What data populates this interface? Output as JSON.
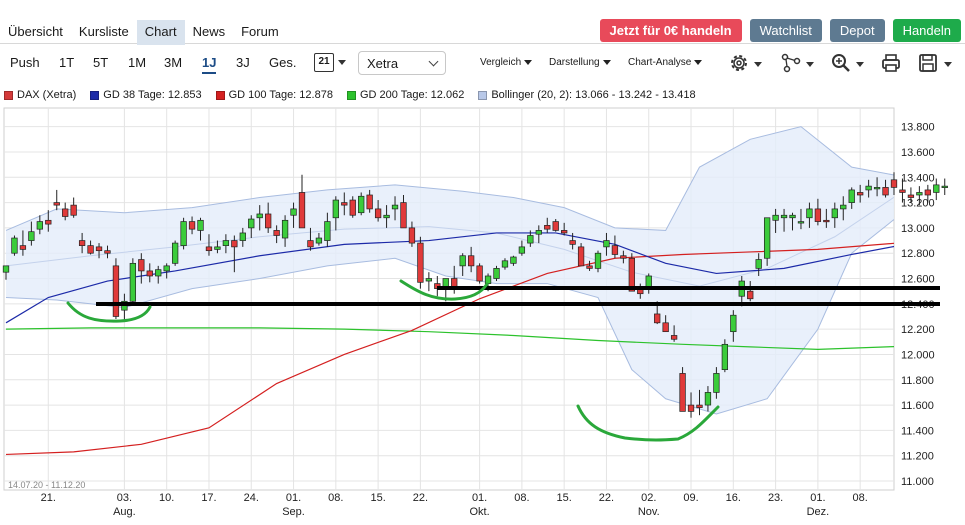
{
  "nav": {
    "items": [
      "Übersicht",
      "Kursliste",
      "Chart",
      "News",
      "Forum"
    ],
    "active": "Chart"
  },
  "actions": {
    "trade": "Jetzt für 0€ handeln",
    "watchlist": "Watchlist",
    "depot": "Depot",
    "handeln": "Handeln"
  },
  "toolbar": {
    "ranges": [
      "Push",
      "1T",
      "5T",
      "1M",
      "3M",
      "1J",
      "3J",
      "Ges."
    ],
    "active_range": "1J",
    "calendar_label": "21",
    "exchange": "Xetra",
    "menus": [
      "Vergleich",
      "Darstellung",
      "Chart-Analyse"
    ],
    "icons": [
      "settings-gear-icon",
      "share-network-icon",
      "zoom-icon",
      "print-icon",
      "save-icon"
    ]
  },
  "legend": [
    {
      "label": "DAX (Xetra)",
      "color": "#d43a3a"
    },
    {
      "label": "GD 38 Tage: 12.853",
      "color": "#1c2aa8"
    },
    {
      "label": "GD 100 Tage: 12.878",
      "color": "#d42020"
    },
    {
      "label": "GD 200 Tage: 12.062",
      "color": "#2cc22c"
    },
    {
      "label": "Bollinger (20, 2): 13.066 - 13.242 - 13.418",
      "color": "#b8c8e8"
    }
  ],
  "chart_data": {
    "type": "candlestick",
    "date_range": "14.07.20 - 11.12.20",
    "ylim": [
      11000,
      13900
    ],
    "y_ticks": [
      11000,
      11200,
      11400,
      11600,
      11800,
      12000,
      12200,
      12400,
      12600,
      12800,
      13000,
      13200,
      13400,
      13600,
      13800
    ],
    "y_tick_labels": [
      "11.000",
      "11.200",
      "11.400",
      "11.600",
      "11.800",
      "12.000",
      "12.200",
      "12.400",
      "12.600",
      "12.800",
      "13.000",
      "13.200",
      "13.400",
      "13.600",
      "13.800"
    ],
    "x_ticks": [
      {
        "day": 5,
        "label": "21."
      },
      {
        "day": 14,
        "label": "03."
      },
      {
        "day": 19,
        "label": "10."
      },
      {
        "day": 24,
        "label": "17."
      },
      {
        "day": 29,
        "label": "24."
      },
      {
        "day": 34,
        "label": "01."
      },
      {
        "day": 39,
        "label": "08."
      },
      {
        "day": 44,
        "label": "15."
      },
      {
        "day": 49,
        "label": "22."
      },
      {
        "day": 56,
        "label": "01."
      },
      {
        "day": 61,
        "label": "08."
      },
      {
        "day": 66,
        "label": "15."
      },
      {
        "day": 71,
        "label": "22."
      },
      {
        "day": 76,
        "label": "02."
      },
      {
        "day": 81,
        "label": "09."
      },
      {
        "day": 86,
        "label": "16."
      },
      {
        "day": 91,
        "label": "23."
      },
      {
        "day": 96,
        "label": "01."
      },
      {
        "day": 101,
        "label": "08."
      }
    ],
    "month_labels": [
      {
        "day": 14,
        "label": "Aug."
      },
      {
        "day": 34,
        "label": "Sep."
      },
      {
        "day": 56,
        "label": "Okt."
      },
      {
        "day": 76,
        "label": "Nov."
      },
      {
        "day": 96,
        "label": "Dez."
      }
    ],
    "num_days": 106,
    "candles": [
      [
        12650,
        12700,
        12590,
        12700
      ],
      [
        12800,
        12940,
        12780,
        12920
      ],
      [
        12860,
        12980,
        12780,
        12830
      ],
      [
        12900,
        13050,
        12860,
        12970
      ],
      [
        12990,
        13100,
        12950,
        13050
      ],
      [
        13060,
        13140,
        12970,
        13030
      ],
      [
        13200,
        13300,
        13140,
        13180
      ],
      [
        13150,
        13200,
        13060,
        13090
      ],
      [
        13180,
        13240,
        13080,
        13100
      ],
      [
        12900,
        12960,
        12800,
        12860
      ],
      [
        12860,
        12900,
        12790,
        12800
      ],
      [
        12850,
        12880,
        12760,
        12820
      ],
      [
        12820,
        12860,
        12760,
        12800
      ],
      [
        12700,
        12760,
        12280,
        12300
      ],
      [
        12350,
        12480,
        12260,
        12420
      ],
      [
        12420,
        12760,
        12390,
        12720
      ],
      [
        12750,
        12800,
        12560,
        12660
      ],
      [
        12660,
        12720,
        12570,
        12620
      ],
      [
        12620,
        12700,
        12560,
        12670
      ],
      [
        12660,
        12720,
        12600,
        12700
      ],
      [
        12720,
        12900,
        12700,
        12880
      ],
      [
        12860,
        13080,
        12830,
        13050
      ],
      [
        13050,
        13090,
        12950,
        12990
      ],
      [
        12980,
        13080,
        12900,
        13060
      ],
      [
        12850,
        12950,
        12780,
        12820
      ],
      [
        12830,
        12900,
        12800,
        12850
      ],
      [
        12860,
        12950,
        12800,
        12900
      ],
      [
        12900,
        12940,
        12650,
        12850
      ],
      [
        12900,
        13000,
        12850,
        12960
      ],
      [
        13000,
        13100,
        12920,
        13070
      ],
      [
        13080,
        13180,
        12980,
        13110
      ],
      [
        13110,
        13200,
        12960,
        13000
      ],
      [
        12980,
        13020,
        12880,
        12940
      ],
      [
        12920,
        13100,
        12850,
        13060
      ],
      [
        13100,
        13200,
        13000,
        13150
      ],
      [
        13280,
        13420,
        13100,
        13000
      ],
      [
        12900,
        13000,
        12820,
        12850
      ],
      [
        12880,
        12960,
        12860,
        12920
      ],
      [
        12900,
        13120,
        12850,
        13050
      ],
      [
        13080,
        13250,
        12980,
        13220
      ],
      [
        13200,
        13280,
        13100,
        13180
      ],
      [
        13220,
        13250,
        13080,
        13100
      ],
      [
        13120,
        13280,
        13100,
        13250
      ],
      [
        13260,
        13300,
        13120,
        13150
      ],
      [
        13150,
        13220,
        13050,
        13080
      ],
      [
        13080,
        13180,
        13000,
        13100
      ],
      [
        13150,
        13250,
        13060,
        13180
      ],
      [
        13200,
        13260,
        13000,
        13000
      ],
      [
        13000,
        13050,
        12850,
        12880
      ],
      [
        12880,
        12930,
        12520,
        12570
      ],
      [
        12580,
        12650,
        12500,
        12600
      ],
      [
        12560,
        12620,
        12460,
        12520
      ],
      [
        12520,
        12600,
        12420,
        12600
      ],
      [
        12600,
        12700,
        12480,
        12520
      ],
      [
        12700,
        12800,
        12620,
        12780
      ],
      [
        12780,
        12850,
        12650,
        12700
      ],
      [
        12700,
        12720,
        12560,
        12580
      ],
      [
        12560,
        12640,
        12500,
        12620
      ],
      [
        12600,
        12700,
        12580,
        12680
      ],
      [
        12690,
        12760,
        12670,
        12740
      ],
      [
        12720,
        12780,
        12700,
        12770
      ],
      [
        12800,
        12900,
        12780,
        12850
      ],
      [
        12880,
        12980,
        12850,
        12940
      ],
      [
        12950,
        13020,
        12880,
        12980
      ],
      [
        13020,
        13080,
        12960,
        12990
      ],
      [
        13050,
        13070,
        12970,
        12980
      ],
      [
        12980,
        13040,
        12940,
        12960
      ],
      [
        12900,
        12960,
        12830,
        12870
      ],
      [
        12850,
        12880,
        12750,
        12700
      ],
      [
        12700,
        12740,
        12660,
        12680
      ],
      [
        12680,
        12820,
        12650,
        12800
      ],
      [
        12850,
        12960,
        12780,
        12900
      ],
      [
        12860,
        12940,
        12760,
        12790
      ],
      [
        12780,
        12820,
        12720,
        12760
      ],
      [
        12760,
        12800,
        12520,
        12500
      ],
      [
        12530,
        12560,
        12440,
        12480
      ],
      [
        12520,
        12640,
        12480,
        12620
      ],
      [
        12320,
        12420,
        12240,
        12250
      ],
      [
        12250,
        12310,
        12180,
        12180
      ],
      [
        12150,
        12230,
        12100,
        12120
      ],
      [
        11850,
        11900,
        11550,
        11550
      ],
      [
        11600,
        11700,
        11500,
        11550
      ],
      [
        11600,
        11720,
        11520,
        11580
      ],
      [
        11600,
        11750,
        11550,
        11700
      ],
      [
        11700,
        11900,
        11650,
        11850
      ],
      [
        11880,
        12120,
        11860,
        12080
      ],
      [
        12180,
        12350,
        12100,
        12310
      ],
      [
        12460,
        12620,
        12380,
        12580
      ],
      [
        12500,
        12580,
        12420,
        12440
      ],
      [
        12680,
        12800,
        12620,
        12750
      ],
      [
        12760,
        13000,
        12700,
        13080
      ],
      [
        13060,
        13150,
        12960,
        13100
      ],
      [
        13080,
        13150,
        12970,
        13100
      ],
      [
        13080,
        13120,
        12980,
        13100
      ],
      [
        13040,
        13150,
        12990,
        13050
      ],
      [
        13080,
        13200,
        13000,
        13150
      ],
      [
        13150,
        13230,
        13020,
        13050
      ],
      [
        13060,
        13150,
        13000,
        13050
      ],
      [
        13080,
        13200,
        13000,
        13150
      ],
      [
        13150,
        13250,
        13060,
        13180
      ],
      [
        13200,
        13320,
        13150,
        13300
      ],
      [
        13280,
        13340,
        13200,
        13260
      ],
      [
        13300,
        13380,
        13240,
        13330
      ],
      [
        13310,
        13400,
        13250,
        13320
      ],
      [
        13320,
        13380,
        13240,
        13260
      ],
      [
        13380,
        13440,
        13260,
        13320
      ],
      [
        13300,
        13390,
        13200,
        13280
      ],
      [
        13260,
        13320,
        13200,
        13240
      ],
      [
        13260,
        13330,
        13180,
        13280
      ],
      [
        13300,
        13340,
        13200,
        13260
      ],
      [
        13280,
        13390,
        13220,
        13340
      ],
      [
        13320,
        13390,
        13260,
        13330
      ]
    ],
    "gd38": [
      [
        0,
        12250
      ],
      [
        5,
        12450
      ],
      [
        12,
        12580
      ],
      [
        20,
        12660
      ],
      [
        30,
        12780
      ],
      [
        40,
        12870
      ],
      [
        50,
        12900
      ],
      [
        58,
        12960
      ],
      [
        65,
        12960
      ],
      [
        72,
        12870
      ],
      [
        78,
        12720
      ],
      [
        84,
        12640
      ],
      [
        92,
        12680
      ],
      [
        100,
        12790
      ],
      [
        105,
        12853
      ]
    ],
    "gd100": [
      [
        0,
        11210
      ],
      [
        8,
        11230
      ],
      [
        16,
        11290
      ],
      [
        24,
        11420
      ],
      [
        32,
        11770
      ],
      [
        40,
        12000
      ],
      [
        48,
        12190
      ],
      [
        56,
        12440
      ],
      [
        64,
        12640
      ],
      [
        72,
        12760
      ],
      [
        80,
        12790
      ],
      [
        88,
        12810
      ],
      [
        96,
        12830
      ],
      [
        105,
        12878
      ]
    ],
    "gd200": [
      [
        0,
        12200
      ],
      [
        10,
        12210
      ],
      [
        20,
        12210
      ],
      [
        30,
        12210
      ],
      [
        40,
        12200
      ],
      [
        50,
        12180
      ],
      [
        60,
        12150
      ],
      [
        70,
        12110
      ],
      [
        80,
        12080
      ],
      [
        88,
        12060
      ],
      [
        96,
        12040
      ],
      [
        105,
        12062
      ]
    ],
    "bollinger_upper": [
      [
        0,
        12980
      ],
      [
        6,
        13150
      ],
      [
        14,
        13120
      ],
      [
        22,
        13160
      ],
      [
        30,
        13240
      ],
      [
        38,
        13300
      ],
      [
        46,
        13340
      ],
      [
        54,
        13290
      ],
      [
        60,
        13240
      ],
      [
        66,
        13160
      ],
      [
        72,
        13000
      ],
      [
        78,
        12980
      ],
      [
        82,
        13480
      ],
      [
        88,
        13700
      ],
      [
        94,
        13800
      ],
      [
        100,
        13480
      ],
      [
        105,
        13418
      ]
    ],
    "bollinger_lower": [
      [
        0,
        12450
      ],
      [
        6,
        12430
      ],
      [
        14,
        12370
      ],
      [
        22,
        12520
      ],
      [
        30,
        12600
      ],
      [
        38,
        12700
      ],
      [
        46,
        12760
      ],
      [
        52,
        12620
      ],
      [
        58,
        12560
      ],
      [
        64,
        12560
      ],
      [
        70,
        12450
      ],
      [
        74,
        11880
      ],
      [
        78,
        11650
      ],
      [
        84,
        11530
      ],
      [
        90,
        11650
      ],
      [
        96,
        12200
      ],
      [
        100,
        12800
      ],
      [
        105,
        13066
      ]
    ],
    "bollinger_mid": [
      [
        0,
        12700
      ],
      [
        10,
        12780
      ],
      [
        20,
        12850
      ],
      [
        30,
        12930
      ],
      [
        40,
        12990
      ],
      [
        50,
        13010
      ],
      [
        58,
        12960
      ],
      [
        66,
        12830
      ],
      [
        74,
        12650
      ],
      [
        82,
        12540
      ],
      [
        90,
        12680
      ],
      [
        98,
        12930
      ],
      [
        105,
        13242
      ]
    ],
    "support_lines": [
      12450,
      12320
    ],
    "annotations": "hand-drawn green arcs marking local lows"
  }
}
